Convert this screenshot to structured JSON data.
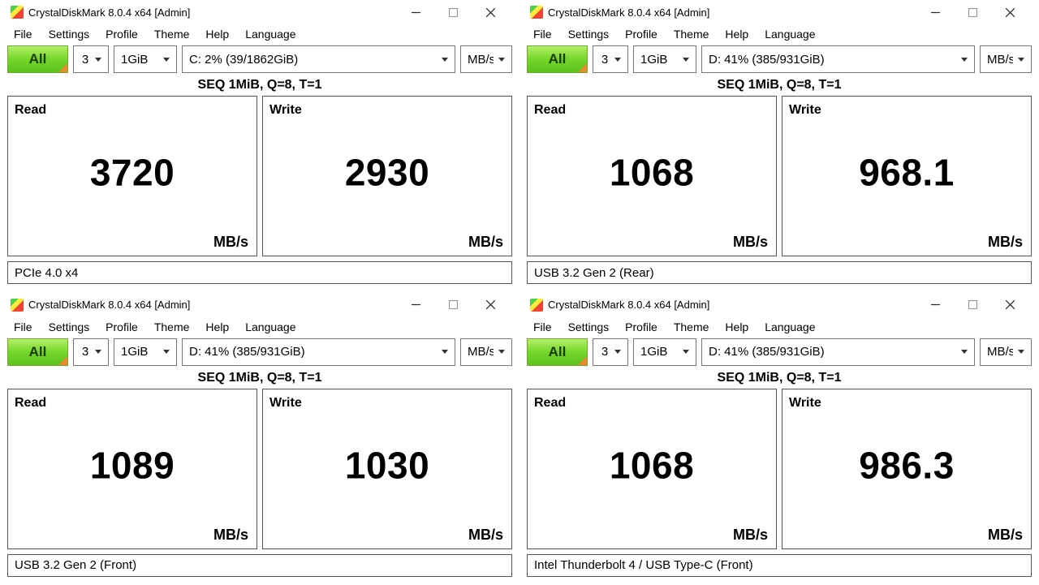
{
  "menu": {
    "file": "File",
    "settings": "Settings",
    "profile": "Profile",
    "theme": "Theme",
    "help": "Help",
    "language": "Language"
  },
  "toolbar": {
    "all": "All",
    "runs": "3",
    "size": "1GiB",
    "unit": "MB/s"
  },
  "test_label": "SEQ 1MiB, Q=8, T=1",
  "read_label": "Read",
  "write_label": "Write",
  "speed_unit": "MB/s",
  "windows": [
    {
      "title": "CrystalDiskMark 8.0.4 x64 [Admin]",
      "drive": "C: 2% (39/1862GiB)",
      "read": "3720",
      "write": "2930",
      "comment": "PCIe 4.0 x4"
    },
    {
      "title": "CrystalDiskMark 8.0.4 x64 [Admin]",
      "drive": "D: 41% (385/931GiB)",
      "read": "1068",
      "write": "968.1",
      "comment": "USB 3.2 Gen 2 (Rear)"
    },
    {
      "title": "CrystalDiskMark 8.0.4 x64 [Admin]",
      "drive": "D: 41% (385/931GiB)",
      "read": "1089",
      "write": "1030",
      "comment": "USB 3.2 Gen 2 (Front)"
    },
    {
      "title": "CrystalDiskMark 8.0.4 x64 [Admin]",
      "drive": "D: 41% (385/931GiB)",
      "read": "1068",
      "write": "986.3",
      "comment": "Intel Thunderbolt 4 / USB Type-C (Front)"
    }
  ]
}
